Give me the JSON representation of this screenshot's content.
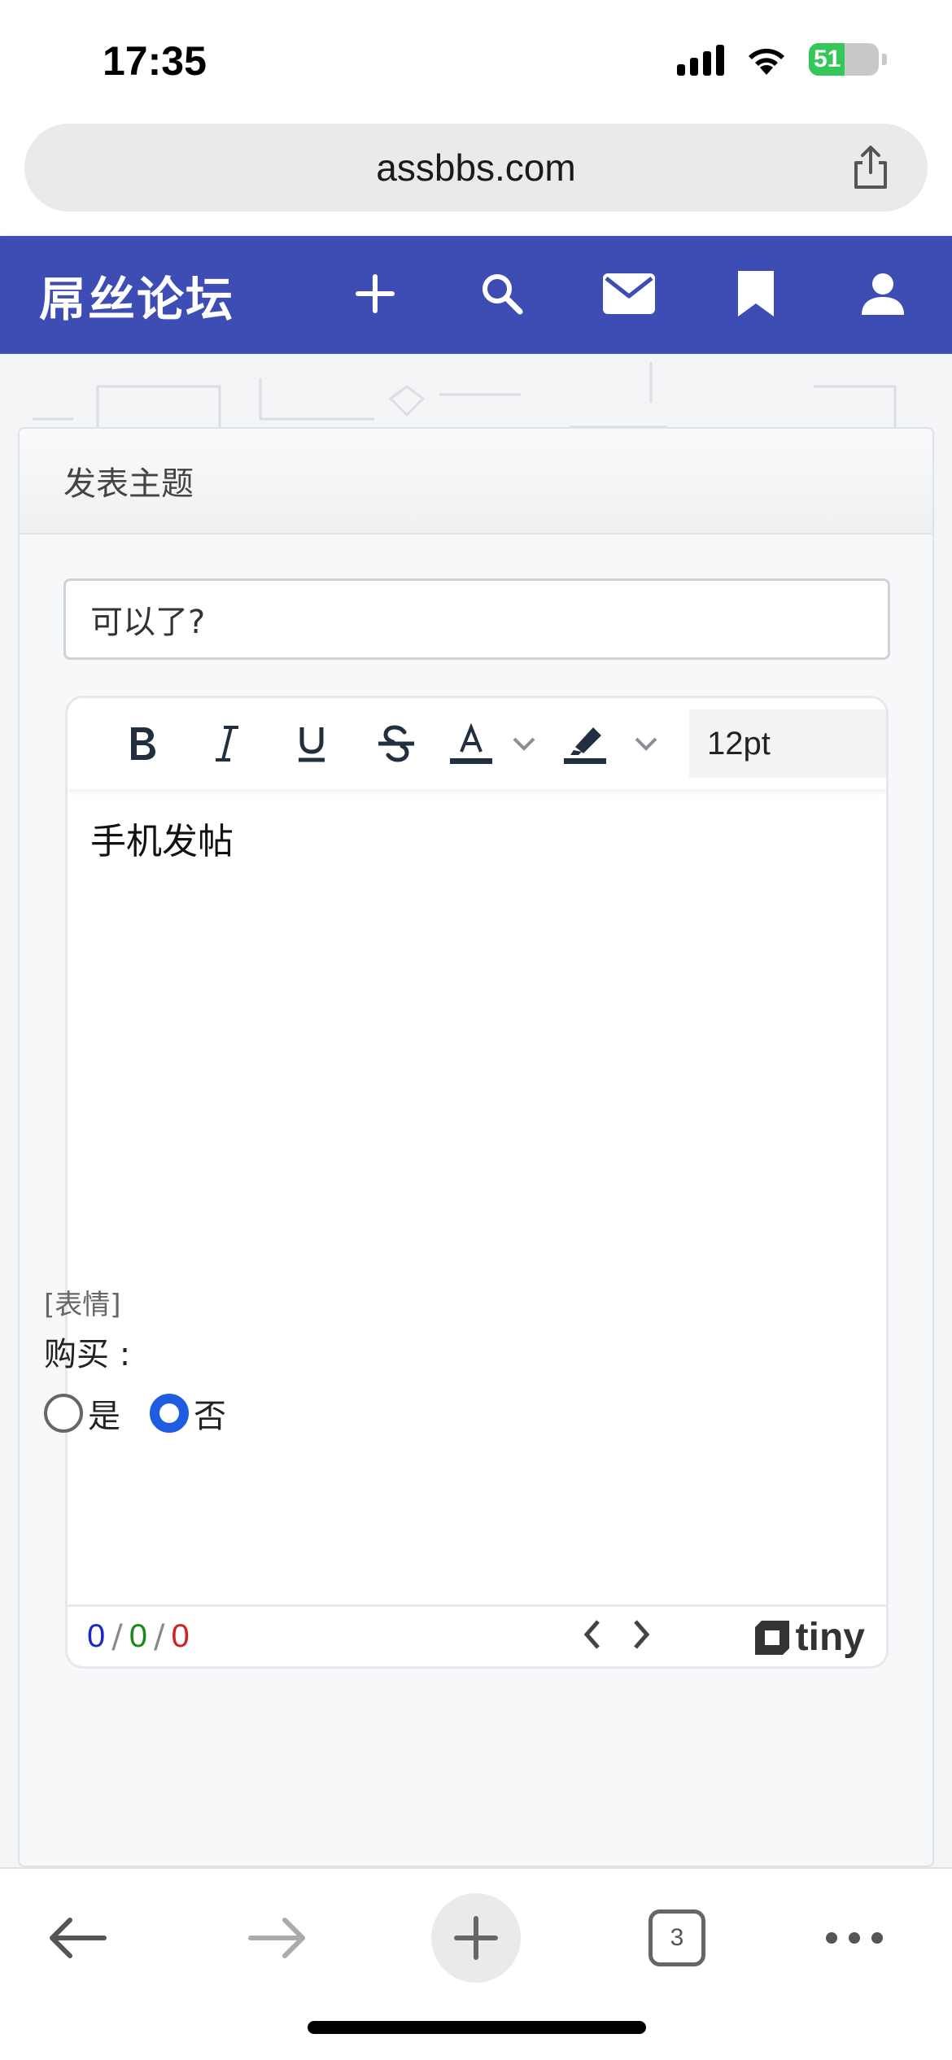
{
  "status_bar": {
    "time": "17:35",
    "battery_percent": 51,
    "battery_label": "51",
    "icons": [
      "signal-icon",
      "wifi-icon",
      "battery-icon"
    ]
  },
  "browser": {
    "url": "assbbs.com",
    "open_tab_count": "3"
  },
  "header": {
    "brand": "屌丝论坛",
    "icons": [
      "plus-icon",
      "search-icon",
      "mail-icon",
      "bookmark-icon",
      "user-icon"
    ]
  },
  "compose": {
    "card_title": "发表主题",
    "subject_value": "可以了?",
    "font_size": "12pt",
    "body_text": "手机发帖",
    "counts": [
      "0",
      "0",
      "0"
    ],
    "count_separator": "/",
    "tiny_label": "tiny",
    "emoji_link": "[表情]",
    "buy_label": "购买 :",
    "buy_options": [
      "是",
      "否"
    ],
    "buy_selected": "否"
  },
  "colors": {
    "header_bg": "#3d4db3",
    "count_blue": "#1a28c8",
    "count_green": "#1a8a1a",
    "count_red": "#d22020",
    "radio_checked": "#1f5ce0"
  }
}
